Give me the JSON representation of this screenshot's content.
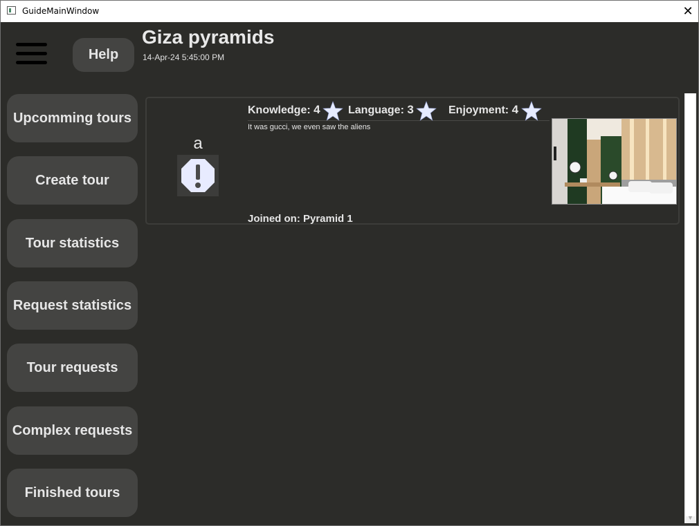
{
  "window": {
    "title": "GuideMainWindow",
    "close_glyph": "✕"
  },
  "header": {
    "help_label": "Help",
    "title": "Giza pyramids",
    "date": "14-Apr-24 5:45:00 PM"
  },
  "sidebar": {
    "items": [
      {
        "label": "Upcomming tours"
      },
      {
        "label": "Create tour"
      },
      {
        "label": "Tour statistics"
      },
      {
        "label": "Request statistics"
      },
      {
        "label": "Tour requests"
      },
      {
        "label": "Complex requests"
      },
      {
        "label": "Finished tours"
      }
    ]
  },
  "reviews": [
    {
      "user_initial": "a",
      "avatar_icon": "warning-octagon-icon",
      "ratings": [
        {
          "label": "Knowledge:",
          "value": "4"
        },
        {
          "label": "Language:",
          "value": "3"
        },
        {
          "label": "Enjoyment:",
          "value": "4"
        }
      ],
      "comment": "It was gucci, we even saw the aliens",
      "joined": "Joined on: Pyramid 1",
      "photo_icon": "hotel-room-photo"
    }
  ],
  "colors": {
    "background": "#2c2c29",
    "button": "#444442",
    "text": "#e6e6e6",
    "star": "#e6ebff"
  }
}
